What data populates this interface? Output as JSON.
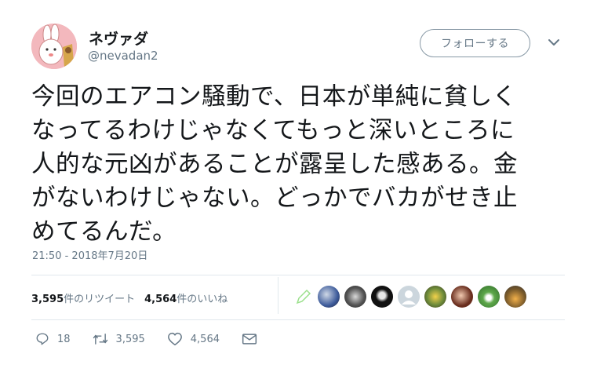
{
  "user": {
    "display_name": "ネヴァダ",
    "handle": "@nevadan2"
  },
  "follow_button": {
    "label": "フォローする"
  },
  "tweet": {
    "lines": [
      "今回のエアコン騒動で、日本が単純に貧しく",
      "なってるわけじゃなくてもっと深いところに",
      "人的な元凶があることが露呈した感ある。金",
      "がないわけじゃない。どっかでバカがせき止",
      "めてるんだ。"
    ],
    "timestamp": "21:50 - 2018年7月20日"
  },
  "stats": {
    "retweets_count": "3,595",
    "retweets_label": "件のリツイート",
    "likes_count": "4,564",
    "likes_label": "件のいいね"
  },
  "actions": {
    "reply_count": "18",
    "retweet_count": "3,595",
    "like_count": "4,564"
  },
  "likers": [
    "liker-avatar-1",
    "liker-avatar-2",
    "liker-avatar-3",
    "liker-avatar-4",
    "liker-avatar-5",
    "liker-avatar-6",
    "liker-avatar-7",
    "liker-avatar-8",
    "liker-avatar-9"
  ],
  "colors": {
    "text": "#14171a",
    "secondary": "#657786",
    "border": "#e1e8ed",
    "avatar_bg": "#f3b8bd"
  }
}
